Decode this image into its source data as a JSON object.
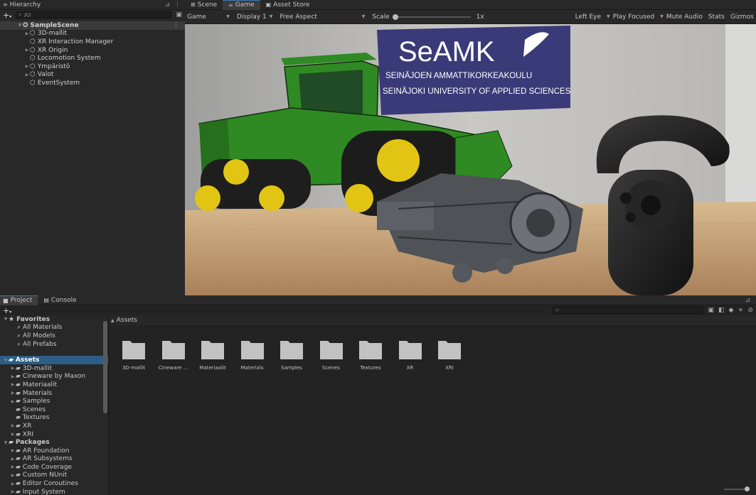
{
  "hierarchy": {
    "tab_label": "Hierarchy",
    "search_placeholder": "All",
    "items": [
      {
        "label": "SampleScene",
        "depth": 0,
        "expand": "open",
        "kind": "scene"
      },
      {
        "label": "3D-mallit",
        "depth": 1,
        "expand": "closed",
        "kind": "object"
      },
      {
        "label": "XR Interaction Manager",
        "depth": 1,
        "expand": "none",
        "kind": "object"
      },
      {
        "label": "XR Origin",
        "depth": 1,
        "expand": "closed",
        "kind": "object"
      },
      {
        "label": "Locomotion System",
        "depth": 1,
        "expand": "none",
        "kind": "object"
      },
      {
        "label": "Ympäristö",
        "depth": 1,
        "expand": "closed",
        "kind": "object"
      },
      {
        "label": "Valot",
        "depth": 1,
        "expand": "closed",
        "kind": "object"
      },
      {
        "label": "EventSystem",
        "depth": 1,
        "expand": "none",
        "kind": "object"
      }
    ]
  },
  "view_tabs": [
    {
      "label": "Scene",
      "icon": "grid-icon"
    },
    {
      "label": "Game",
      "icon": "gamepad-icon"
    },
    {
      "label": "Asset Store",
      "icon": "bag-icon"
    }
  ],
  "game_toolbar": {
    "display_mode": "Game",
    "display": "Display 1",
    "aspect": "Free Aspect",
    "scale_label": "Scale",
    "scale_value": "1x",
    "eye": "Left Eye",
    "play_mode": "Play Focused",
    "mute_audio": "Mute Audio",
    "stats": "Stats",
    "gizmos": "Gizmos"
  },
  "scene": {
    "banner_logo": "SeAMK",
    "banner_line1": "SEINÄJOEN AMMATTIKORKEAKOULU",
    "banner_line2": "SEINÄJOKI UNIVERSITY OF APPLIED SCIENCES"
  },
  "project": {
    "tabs": [
      {
        "label": "Project",
        "icon": "folder-icon"
      },
      {
        "label": "Console",
        "icon": "console-icon"
      }
    ],
    "breadcrumb": "Assets",
    "favorites": {
      "label": "Favorites",
      "items": [
        "All Materials",
        "All Models",
        "All Prefabs"
      ]
    },
    "assets": {
      "label": "Assets",
      "items": [
        {
          "label": "3D-mallit",
          "arrow": true
        },
        {
          "label": "Cineware by Maxon",
          "arrow": true
        },
        {
          "label": "Materiaalit",
          "arrow": true
        },
        {
          "label": "Materials",
          "arrow": true
        },
        {
          "label": "Samples",
          "arrow": true
        },
        {
          "label": "Scenes",
          "arrow": false
        },
        {
          "label": "Textures",
          "arrow": false
        },
        {
          "label": "XR",
          "arrow": true
        },
        {
          "label": "XRI",
          "arrow": true
        }
      ]
    },
    "packages": {
      "label": "Packages",
      "items": [
        "AR Foundation",
        "AR Subsystems",
        "Code Coverage",
        "Custom NUnit",
        "Editor Coroutines",
        "Input System"
      ]
    },
    "grid_items": [
      "3D-mallit",
      "Cineware ...",
      "Materiaalit",
      "Materials",
      "Samples",
      "Scenes",
      "Textures",
      "XR",
      "XRI"
    ]
  },
  "colors": {
    "selection": "#2c5d87",
    "tractor_green": "#2f8a24",
    "tractor_yellow": "#e2c514",
    "banner": "#3b3a78"
  }
}
